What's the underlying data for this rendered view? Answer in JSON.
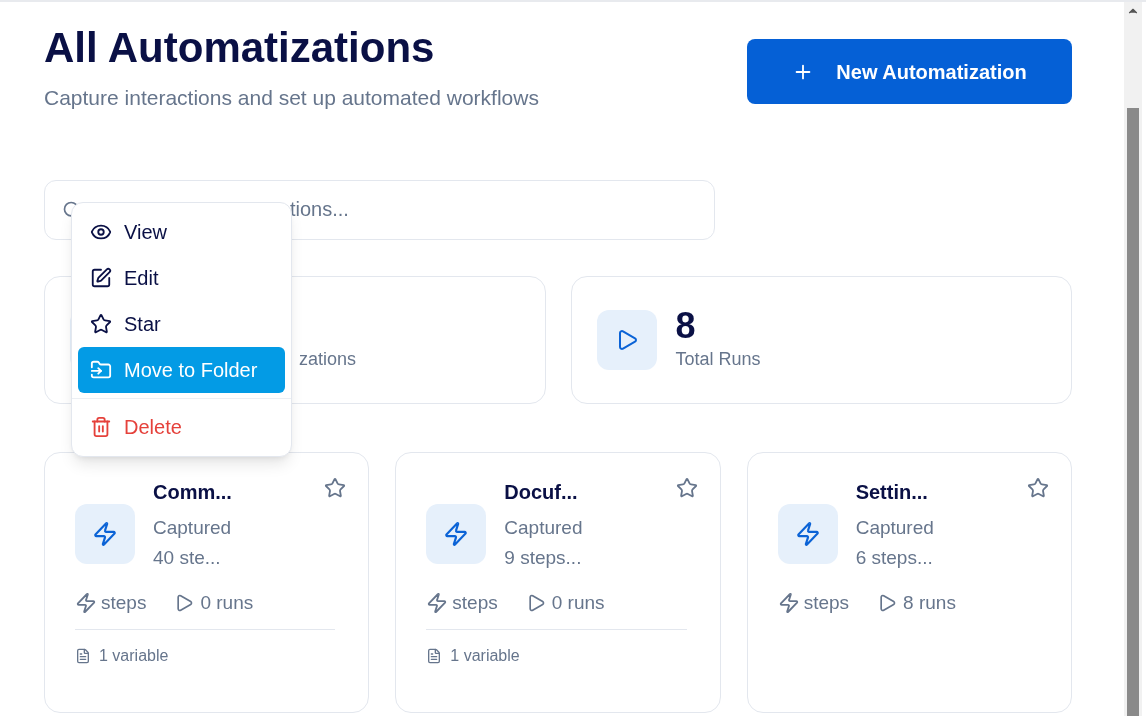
{
  "header": {
    "title": "All Automatizations",
    "subtitle": "Capture interactions and set up automated workflows",
    "new_button": "New Automatization"
  },
  "search": {
    "placeholder": "tions..."
  },
  "stats": [
    {
      "kind": "total",
      "label": "zations"
    },
    {
      "kind": "runs",
      "value": "8",
      "label": "Total Runs"
    }
  ],
  "cards": [
    {
      "title": "Comm...",
      "status": "Captured",
      "summary": "40 ste...",
      "steps": "steps",
      "runs": "0 runs",
      "starred": false,
      "variables": "1 variable"
    },
    {
      "title": "Docuf...",
      "status": "Captured",
      "summary": "9 steps...",
      "steps": "steps",
      "runs": "0 runs",
      "starred": false,
      "variables": "1 variable"
    },
    {
      "title": "Settin...",
      "status": "Captured",
      "summary": "6 steps...",
      "steps": "steps",
      "runs": "8 runs",
      "starred": false
    }
  ],
  "menu": [
    {
      "kind": "view",
      "label": "View",
      "selected": false
    },
    {
      "kind": "edit",
      "label": "Edit",
      "selected": false
    },
    {
      "kind": "star",
      "label": "Star",
      "selected": false
    },
    {
      "kind": "move",
      "label": "Move to Folder",
      "selected": true
    },
    {
      "kind": "delete",
      "label": "Delete",
      "selected": false
    }
  ]
}
